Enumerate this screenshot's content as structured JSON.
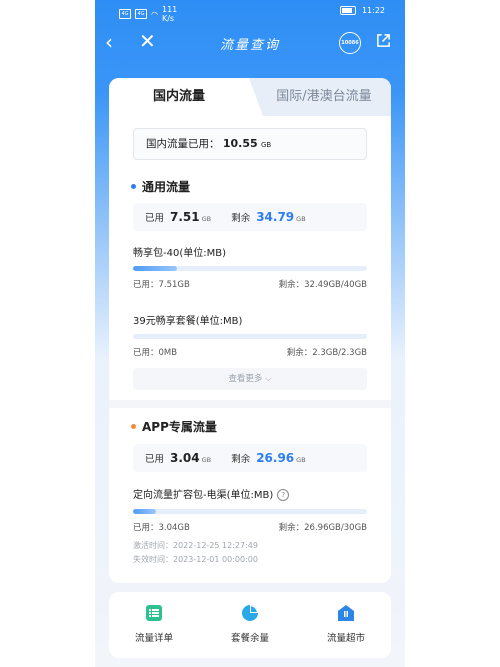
{
  "status": {
    "signal_a": "4G",
    "signal_b": "4G",
    "speed": "111",
    "speed_unit": "K/s",
    "time": "11:22"
  },
  "nav": {
    "title": "流量查询",
    "hotline": "10086"
  },
  "tabs": {
    "active": "国内流量",
    "inactive": "国际/港澳台流量"
  },
  "summary": {
    "label": "国内流量已用：",
    "value": "10.55",
    "unit": "GB"
  },
  "general": {
    "title": "通用流量",
    "used_label": "已用",
    "used_value": "7.51",
    "used_unit": "GB",
    "remain_label": "剩余",
    "remain_value": "34.79",
    "remain_unit": "GB",
    "packages": [
      {
        "name": "畅享包-40(单位:MB)",
        "used": "已用：7.51GB",
        "remain": "剩余：32.49GB/40GB",
        "fill_fraction": 0.19
      },
      {
        "name": "39元畅享套餐(单位:MB)",
        "used": "已用：0MB",
        "remain": "剩余：2.3GB/2.3GB",
        "fill_fraction": 0.0
      }
    ],
    "more_label": "查看更多"
  },
  "app": {
    "title": "APP专属流量",
    "used_label": "已用",
    "used_value": "3.04",
    "used_unit": "GB",
    "remain_label": "剩余",
    "remain_value": "26.96",
    "remain_unit": "GB",
    "package": {
      "name": "定向流量扩容包-电渠(单位:MB)",
      "used": "已用：3.04GB",
      "remain": "剩余：26.96GB/30GB",
      "fill_fraction": 0.1,
      "activate_time": "激活时间：2022-12-25 12:27:49",
      "expire_time": "失效时间：2023-12-01 00:00:00"
    }
  },
  "bottom_nav": [
    {
      "label": "流量详单",
      "icon": "list-icon"
    },
    {
      "label": "套餐余量",
      "icon": "pie-chart-icon"
    },
    {
      "label": "流量超市",
      "icon": "store-icon"
    }
  ],
  "colors": {
    "primary": "#2f8ef5",
    "accent_blue": "#2d7df4",
    "dot_general": "#2d7df4",
    "dot_app": "#f08a3c",
    "icon_green": "#2bc28f",
    "icon_teal": "#2aa8e8"
  }
}
